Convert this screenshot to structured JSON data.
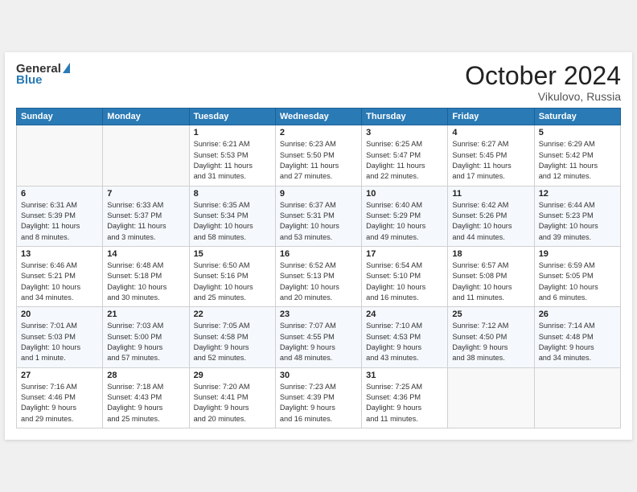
{
  "header": {
    "logo_general": "General",
    "logo_blue": "Blue",
    "month": "October 2024",
    "location": "Vikulovo, Russia"
  },
  "weekdays": [
    "Sunday",
    "Monday",
    "Tuesday",
    "Wednesday",
    "Thursday",
    "Friday",
    "Saturday"
  ],
  "weeks": [
    [
      {
        "day": "",
        "info": ""
      },
      {
        "day": "",
        "info": ""
      },
      {
        "day": "1",
        "info": "Sunrise: 6:21 AM\nSunset: 5:53 PM\nDaylight: 11 hours\nand 31 minutes."
      },
      {
        "day": "2",
        "info": "Sunrise: 6:23 AM\nSunset: 5:50 PM\nDaylight: 11 hours\nand 27 minutes."
      },
      {
        "day": "3",
        "info": "Sunrise: 6:25 AM\nSunset: 5:47 PM\nDaylight: 11 hours\nand 22 minutes."
      },
      {
        "day": "4",
        "info": "Sunrise: 6:27 AM\nSunset: 5:45 PM\nDaylight: 11 hours\nand 17 minutes."
      },
      {
        "day": "5",
        "info": "Sunrise: 6:29 AM\nSunset: 5:42 PM\nDaylight: 11 hours\nand 12 minutes."
      }
    ],
    [
      {
        "day": "6",
        "info": "Sunrise: 6:31 AM\nSunset: 5:39 PM\nDaylight: 11 hours\nand 8 minutes."
      },
      {
        "day": "7",
        "info": "Sunrise: 6:33 AM\nSunset: 5:37 PM\nDaylight: 11 hours\nand 3 minutes."
      },
      {
        "day": "8",
        "info": "Sunrise: 6:35 AM\nSunset: 5:34 PM\nDaylight: 10 hours\nand 58 minutes."
      },
      {
        "day": "9",
        "info": "Sunrise: 6:37 AM\nSunset: 5:31 PM\nDaylight: 10 hours\nand 53 minutes."
      },
      {
        "day": "10",
        "info": "Sunrise: 6:40 AM\nSunset: 5:29 PM\nDaylight: 10 hours\nand 49 minutes."
      },
      {
        "day": "11",
        "info": "Sunrise: 6:42 AM\nSunset: 5:26 PM\nDaylight: 10 hours\nand 44 minutes."
      },
      {
        "day": "12",
        "info": "Sunrise: 6:44 AM\nSunset: 5:23 PM\nDaylight: 10 hours\nand 39 minutes."
      }
    ],
    [
      {
        "day": "13",
        "info": "Sunrise: 6:46 AM\nSunset: 5:21 PM\nDaylight: 10 hours\nand 34 minutes."
      },
      {
        "day": "14",
        "info": "Sunrise: 6:48 AM\nSunset: 5:18 PM\nDaylight: 10 hours\nand 30 minutes."
      },
      {
        "day": "15",
        "info": "Sunrise: 6:50 AM\nSunset: 5:16 PM\nDaylight: 10 hours\nand 25 minutes."
      },
      {
        "day": "16",
        "info": "Sunrise: 6:52 AM\nSunset: 5:13 PM\nDaylight: 10 hours\nand 20 minutes."
      },
      {
        "day": "17",
        "info": "Sunrise: 6:54 AM\nSunset: 5:10 PM\nDaylight: 10 hours\nand 16 minutes."
      },
      {
        "day": "18",
        "info": "Sunrise: 6:57 AM\nSunset: 5:08 PM\nDaylight: 10 hours\nand 11 minutes."
      },
      {
        "day": "19",
        "info": "Sunrise: 6:59 AM\nSunset: 5:05 PM\nDaylight: 10 hours\nand 6 minutes."
      }
    ],
    [
      {
        "day": "20",
        "info": "Sunrise: 7:01 AM\nSunset: 5:03 PM\nDaylight: 10 hours\nand 1 minute."
      },
      {
        "day": "21",
        "info": "Sunrise: 7:03 AM\nSunset: 5:00 PM\nDaylight: 9 hours\nand 57 minutes."
      },
      {
        "day": "22",
        "info": "Sunrise: 7:05 AM\nSunset: 4:58 PM\nDaylight: 9 hours\nand 52 minutes."
      },
      {
        "day": "23",
        "info": "Sunrise: 7:07 AM\nSunset: 4:55 PM\nDaylight: 9 hours\nand 48 minutes."
      },
      {
        "day": "24",
        "info": "Sunrise: 7:10 AM\nSunset: 4:53 PM\nDaylight: 9 hours\nand 43 minutes."
      },
      {
        "day": "25",
        "info": "Sunrise: 7:12 AM\nSunset: 4:50 PM\nDaylight: 9 hours\nand 38 minutes."
      },
      {
        "day": "26",
        "info": "Sunrise: 7:14 AM\nSunset: 4:48 PM\nDaylight: 9 hours\nand 34 minutes."
      }
    ],
    [
      {
        "day": "27",
        "info": "Sunrise: 7:16 AM\nSunset: 4:46 PM\nDaylight: 9 hours\nand 29 minutes."
      },
      {
        "day": "28",
        "info": "Sunrise: 7:18 AM\nSunset: 4:43 PM\nDaylight: 9 hours\nand 25 minutes."
      },
      {
        "day": "29",
        "info": "Sunrise: 7:20 AM\nSunset: 4:41 PM\nDaylight: 9 hours\nand 20 minutes."
      },
      {
        "day": "30",
        "info": "Sunrise: 7:23 AM\nSunset: 4:39 PM\nDaylight: 9 hours\nand 16 minutes."
      },
      {
        "day": "31",
        "info": "Sunrise: 7:25 AM\nSunset: 4:36 PM\nDaylight: 9 hours\nand 11 minutes."
      },
      {
        "day": "",
        "info": ""
      },
      {
        "day": "",
        "info": ""
      }
    ]
  ]
}
